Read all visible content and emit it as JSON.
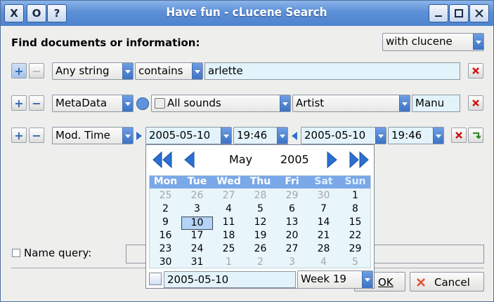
{
  "window": {
    "title": "Have fun - cLucene Search",
    "titlebar_buttons": [
      "X",
      "O",
      "?"
    ]
  },
  "header": {
    "prompt": "Find documents or information:",
    "engine_select": "with clucene"
  },
  "rows": [
    {
      "field_select": "Any string",
      "operator_select": "contains",
      "value": "arlette"
    },
    {
      "field_select": "MetaData",
      "category_select": "All sounds",
      "attribute_select": "Artist",
      "value": "Manu"
    },
    {
      "field_select": "Mod. Time",
      "from_date": "2005-05-10",
      "from_time": "19:46",
      "to_date": "2005-05-10",
      "to_time": "19:46"
    }
  ],
  "calendar": {
    "month": "May",
    "year": "2005",
    "weekdays": [
      "Mon",
      "Tue",
      "Wed",
      "Thu",
      "Fri",
      "Sat",
      "Sun"
    ],
    "weeks": [
      [
        "25",
        "26",
        "27",
        "28",
        "29",
        "30",
        "1"
      ],
      [
        "2",
        "3",
        "4",
        "5",
        "6",
        "7",
        "8"
      ],
      [
        "9",
        "10",
        "11",
        "12",
        "13",
        "14",
        "15"
      ],
      [
        "16",
        "17",
        "18",
        "19",
        "20",
        "21",
        "22"
      ],
      [
        "23",
        "24",
        "25",
        "26",
        "27",
        "28",
        "29"
      ],
      [
        "30",
        "31",
        "1",
        "2",
        "3",
        "4",
        "5"
      ]
    ],
    "date_field": "2005-05-10",
    "week_select": "Week 19"
  },
  "footer": {
    "name_query_label": "Name query:",
    "ok_label": "OK",
    "cancel_label": "Cancel"
  },
  "colors": {
    "titlebar": "#5c8fd6",
    "accent": "#3c72c7",
    "field_bg": "#e3f3fb"
  }
}
